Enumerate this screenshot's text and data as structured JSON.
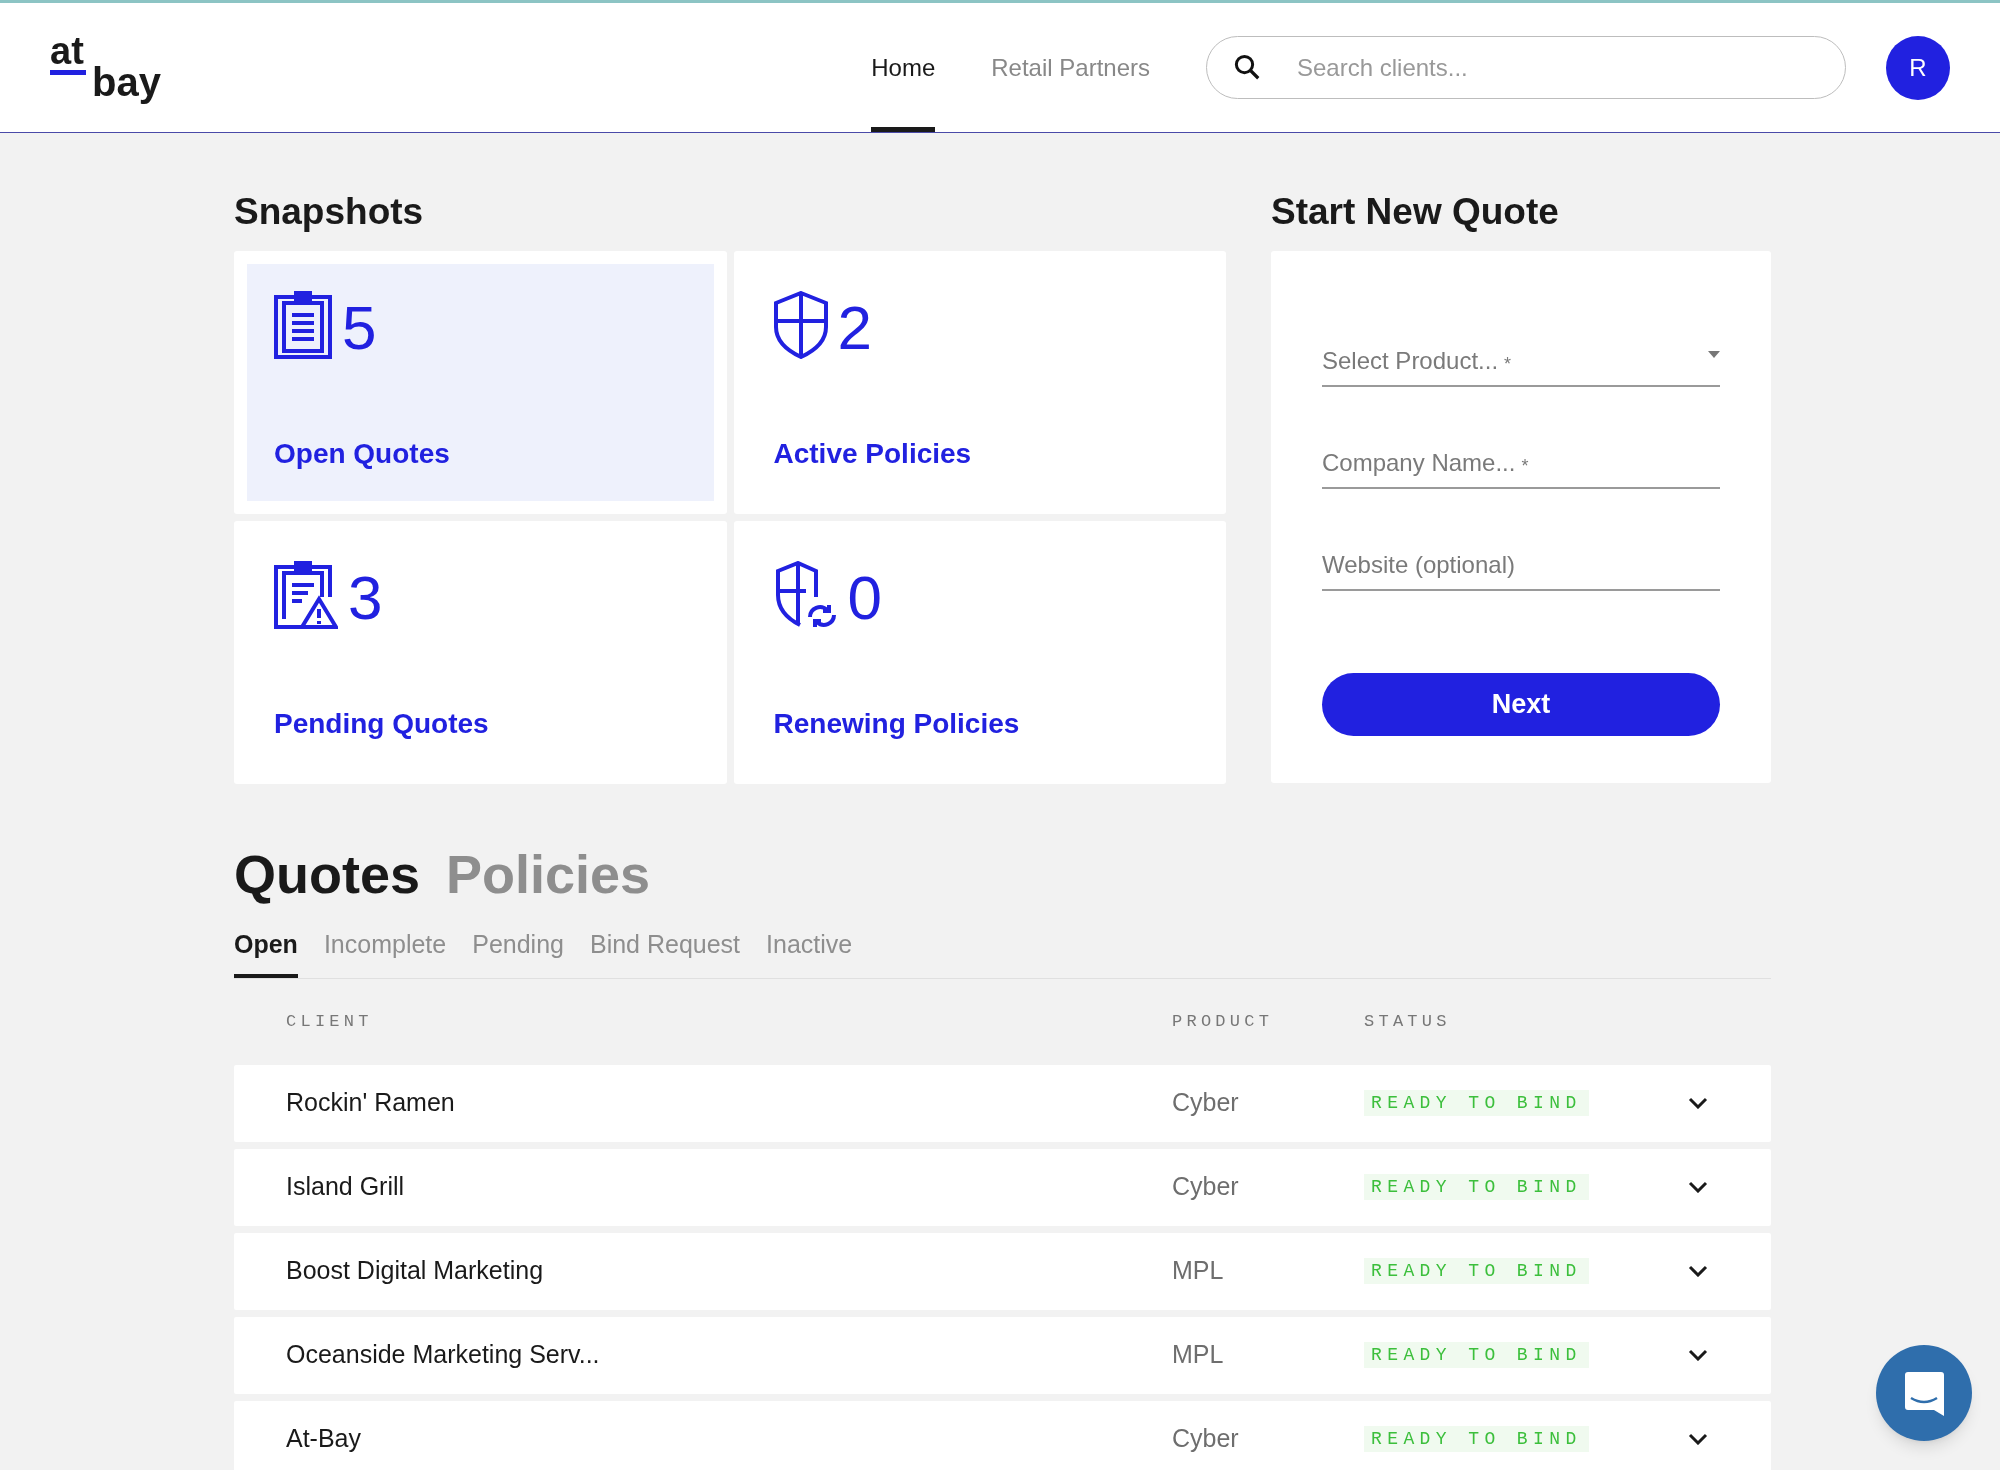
{
  "header": {
    "logo_top": "at",
    "logo_bottom": "bay",
    "nav": [
      {
        "label": "Home",
        "selected": true
      },
      {
        "label": "Retail Partners",
        "selected": false
      }
    ],
    "search": {
      "placeholder": "Search clients..."
    },
    "avatar": "R"
  },
  "snapshots": {
    "title": "Snapshots",
    "cards": [
      {
        "kind": "clipboard",
        "count": "5",
        "label": "Open Quotes",
        "selected": true
      },
      {
        "kind": "shield",
        "count": "2",
        "label": "Active Policies",
        "selected": false
      },
      {
        "kind": "clipboard-warning",
        "count": "3",
        "label": "Pending Quotes",
        "selected": false
      },
      {
        "kind": "shield-renew",
        "count": "0",
        "label": "Renewing Policies",
        "selected": false
      }
    ]
  },
  "new_quote": {
    "title": "Start New Quote",
    "fields": [
      {
        "kind": "select",
        "placeholder": "Select Product...",
        "required_mark": "*"
      },
      {
        "kind": "text",
        "placeholder": "Company Name...",
        "required_mark": "*"
      },
      {
        "kind": "text",
        "placeholder": "Website (optional)"
      }
    ],
    "button": "Next"
  },
  "list": {
    "sections": [
      {
        "label": "Quotes",
        "selected": true
      },
      {
        "label": "Policies",
        "selected": false
      }
    ],
    "tabs": [
      {
        "label": "Open",
        "selected": true
      },
      {
        "label": "Incomplete",
        "selected": false
      },
      {
        "label": "Pending",
        "selected": false
      },
      {
        "label": "Bind Request",
        "selected": false
      },
      {
        "label": "Inactive",
        "selected": false
      }
    ],
    "columns": [
      "CLIENT",
      "PRODUCT",
      "STATUS"
    ],
    "rows": [
      {
        "client": "Rockin' Ramen",
        "product": "Cyber",
        "status": "READY TO BIND"
      },
      {
        "client": "Island Grill",
        "product": "Cyber",
        "status": "READY TO BIND"
      },
      {
        "client": "Boost Digital Marketing",
        "product": "MPL",
        "status": "READY TO BIND"
      },
      {
        "client": "Oceanside Marketing Serv...",
        "product": "MPL",
        "status": "READY TO BIND"
      },
      {
        "client": "At-Bay",
        "product": "Cyber",
        "status": "READY TO BIND"
      }
    ]
  }
}
